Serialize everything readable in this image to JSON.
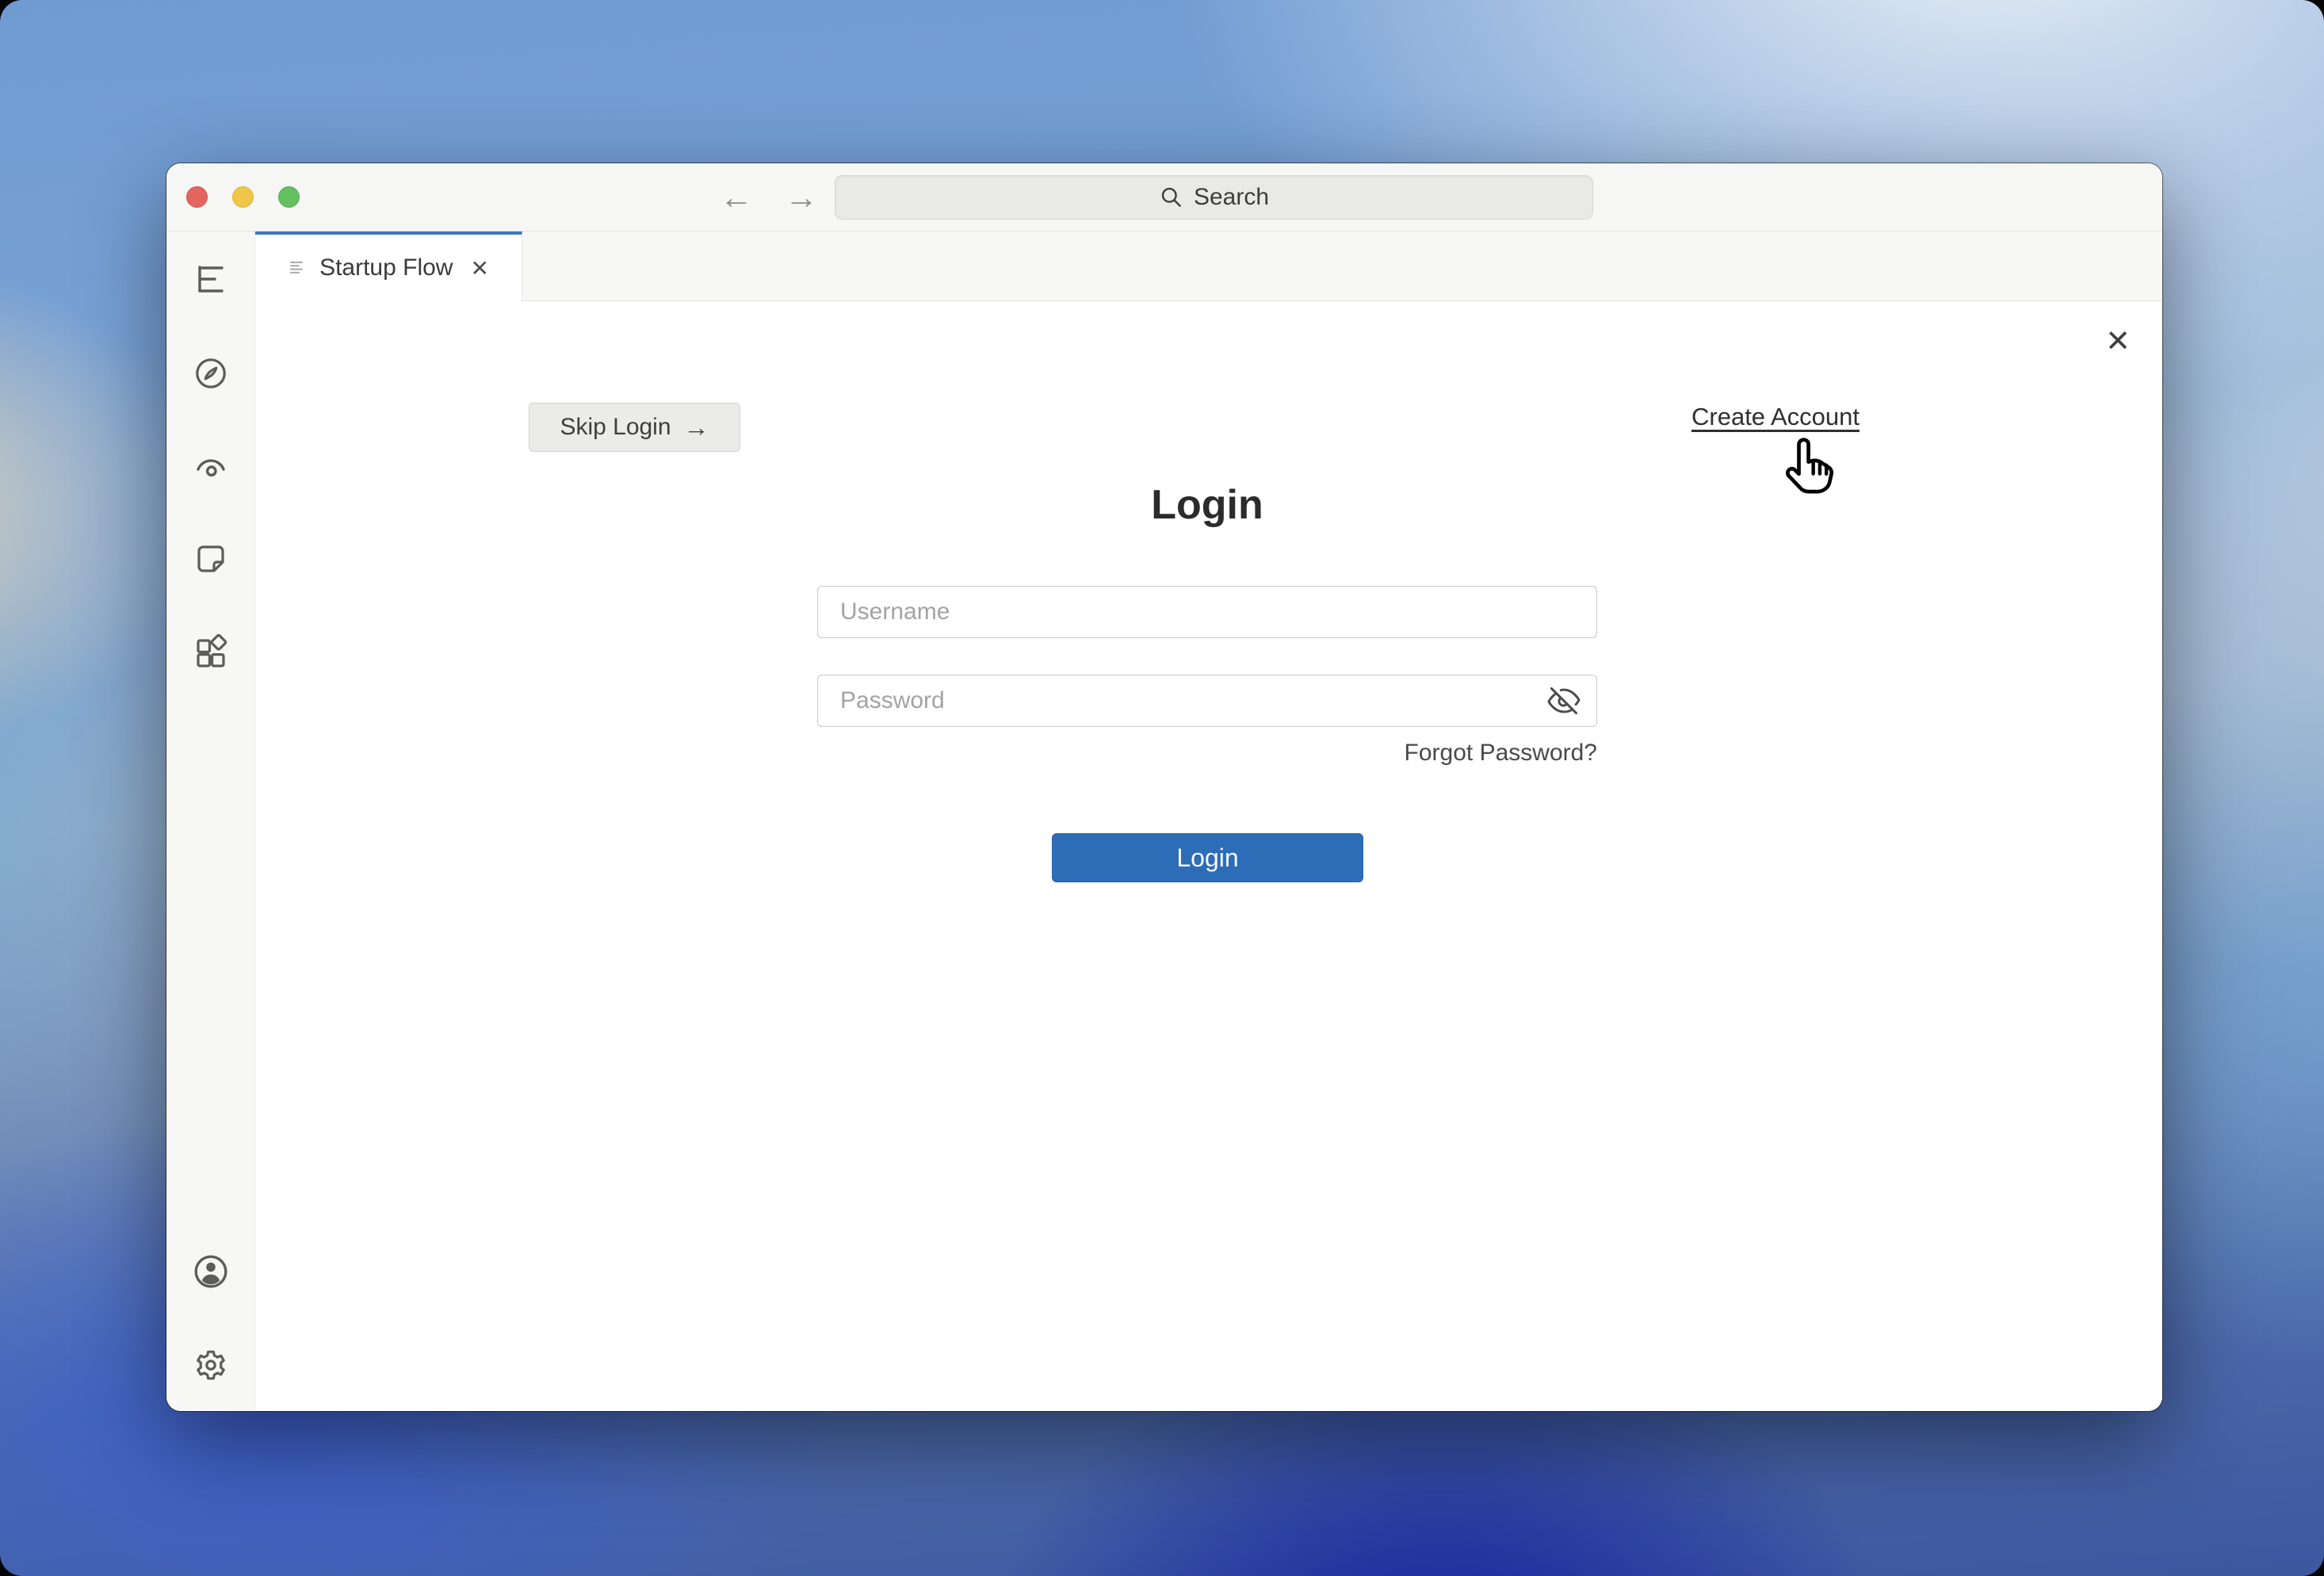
{
  "titlebar": {
    "back_glyph": "←",
    "forward_glyph": "→",
    "search_placeholder": "Search"
  },
  "tabbar": {
    "tab_title": "Startup Flow",
    "tab_close_glyph": "✕"
  },
  "sidebar": {
    "top_items": [
      "outline",
      "compass",
      "preview-eye",
      "note",
      "components"
    ],
    "bottom_items": [
      "account",
      "settings"
    ]
  },
  "panel": {
    "close_glyph": "✕",
    "skip_button_label": "Skip Login",
    "skip_button_arrow": "→",
    "create_account_label": "Create Account"
  },
  "login_form": {
    "title": "Login",
    "username_placeholder": "Username",
    "password_placeholder": "Password",
    "forgot_password_label": "Forgot Password?",
    "submit_label": "Login"
  },
  "colors": {
    "accent_blue": "#2d6db8",
    "tab_indicator": "#3e7ab8",
    "traffic_red": "#e2665f",
    "traffic_yellow": "#f0c64a",
    "traffic_green": "#65c05f"
  }
}
